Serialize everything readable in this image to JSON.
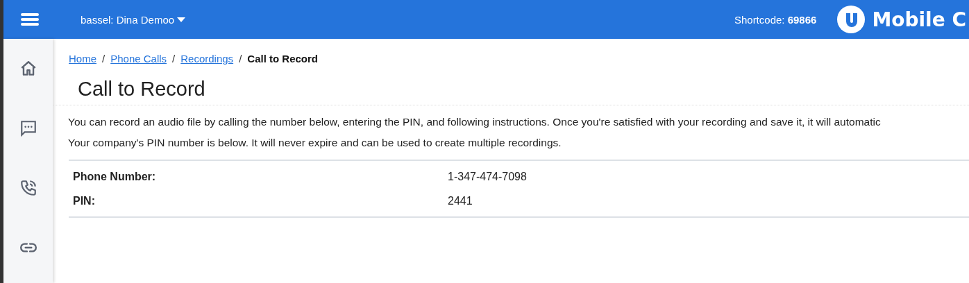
{
  "header": {
    "account": "bassel: Dina Demoo",
    "shortcode": "Shortcode: **69866**",
    "logo_text": "Mobile C"
  },
  "breadcrumb": [
    {
      "label": "Home",
      "kind": "link",
      "separator": "/"
    },
    {
      "label": "Phone Calls",
      "kind": "link",
      "separator": "/"
    },
    {
      "label": "Recordings",
      "kind": "link",
      "separator": "/"
    },
    {
      "label": "Call to Record",
      "kind": "current"
    }
  ],
  "title": "Call to Record",
  "paragraphs": [
    "You can record an audio file by calling the number below, entering the PIN, and following instructions. Once you're satisfied with your recording and save it, it will automatic",
    "Your company's PIN number is below. It will never expire and can be used to create multiple recordings."
  ],
  "details": [
    {
      "label": "Phone Number:",
      "value": "1-347-474-7098"
    },
    {
      "label": "PIN:",
      "value": "2441"
    }
  ]
}
